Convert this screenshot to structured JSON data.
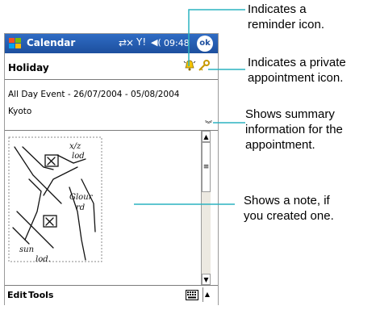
{
  "window": {
    "title": "Calendar",
    "time": "09:48",
    "ok_label": "ok"
  },
  "appointment": {
    "heading": "Holiday",
    "event_line": "All Day Event - 26/07/2004 - 05/08/2004",
    "location": "Kyoto",
    "note_text": [
      "x/z",
      "lod",
      "Glour",
      "rd",
      "sun",
      "lod."
    ]
  },
  "menu": {
    "edit_label": "Edit",
    "tools_label": "Tools"
  },
  "callouts": {
    "reminder": [
      "Indicates a",
      "reminder icon."
    ],
    "private": [
      "Indicates a private",
      "appointment icon."
    ],
    "summary": [
      "Shows summary",
      "information for the",
      "appointment."
    ],
    "note": [
      "Shows a note, if",
      "you created one."
    ]
  },
  "colors": {
    "titlebar": "#1d4f9e",
    "callout_line": "#2bb3c0"
  },
  "icons": {
    "start": "windows-flag-icon",
    "connectivity": "connectivity-icon",
    "signal": "signal-icon",
    "volume": "speaker-icon",
    "reminder": "bell-icon",
    "private": "key-icon",
    "expand": "double-chevron-icon",
    "keyboard": "keyboard-icon"
  }
}
